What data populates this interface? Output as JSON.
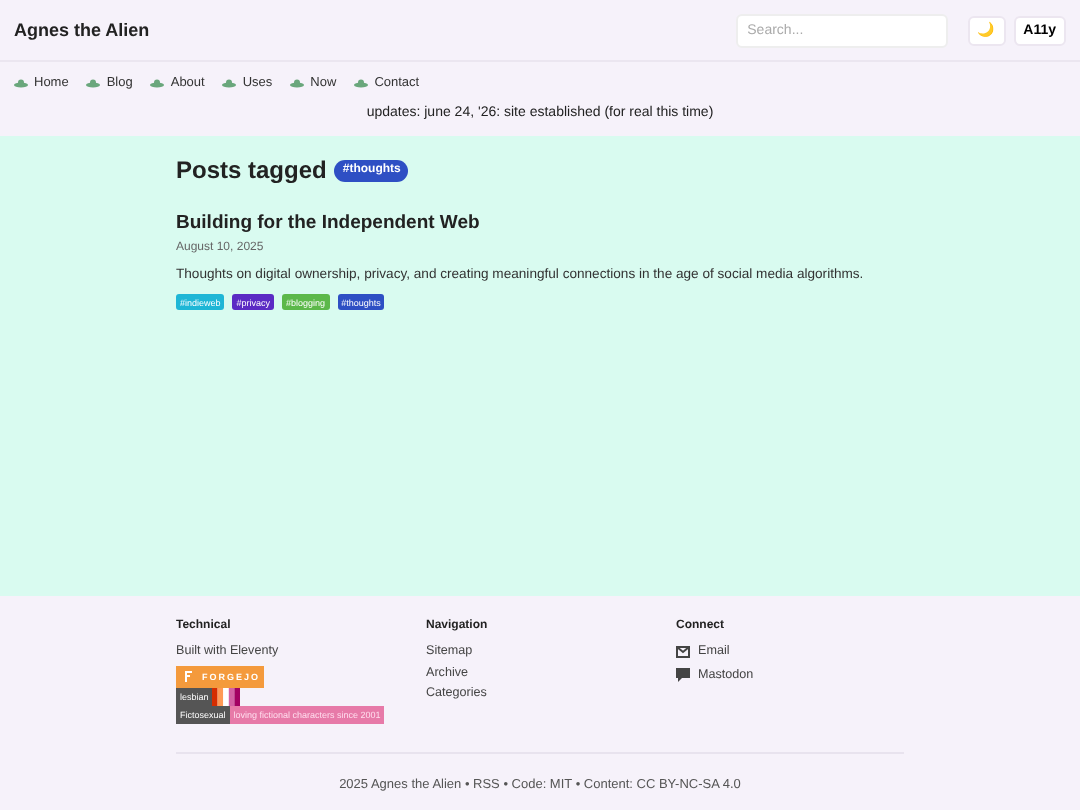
{
  "site": {
    "title": "Agnes the Alien",
    "search": {
      "placeholder": "Search..."
    },
    "theme_toggle": "🌙",
    "a11y": "A11y"
  },
  "nav": [
    {
      "label": "Home"
    },
    {
      "label": "Blog"
    },
    {
      "label": "About"
    },
    {
      "label": "Uses"
    },
    {
      "label": "Now"
    },
    {
      "label": "Contact"
    }
  ],
  "updates": "updates: june 24, '26: site established (for real this time)",
  "page": {
    "heading": "Posts tagged",
    "tag": "#thoughts",
    "posts": [
      {
        "title": "Building for the Independent Web",
        "date": "August 10, 2025",
        "summary": "Thoughts on digital ownership, privacy, and creating meaningful connections in the age of social media algorithms.",
        "tags": [
          {
            "label": "#indieweb",
            "color": "#1fb6d6"
          },
          {
            "label": "#privacy",
            "color": "#5b2bc4"
          },
          {
            "label": "#blogging",
            "color": "#5cb84a"
          },
          {
            "label": "#thoughts",
            "color": "#2e4fc4"
          }
        ]
      }
    ]
  },
  "footer": {
    "columns": [
      {
        "heading": "Technical",
        "links": [
          "Built with Eleventy"
        ],
        "badges": [
          {
            "kind": "forge",
            "label": "FORGEJO"
          },
          {
            "kind": "flag",
            "label": "lesbian"
          },
          {
            "kind": "pink",
            "label": "Fictosexual",
            "value": "loving fictional characters since 2001"
          }
        ]
      },
      {
        "heading": "Navigation",
        "links": [
          "Sitemap",
          "Archive",
          "Categories"
        ]
      },
      {
        "heading": "Connect",
        "contacts": [
          {
            "kind": "email",
            "label": "Email"
          },
          {
            "kind": "chat",
            "label": "Mastodon"
          }
        ]
      }
    ],
    "copyright": "2025 Agnes the Alien • RSS • Code: MIT • Content: CC BY-NC-SA 4.0"
  }
}
